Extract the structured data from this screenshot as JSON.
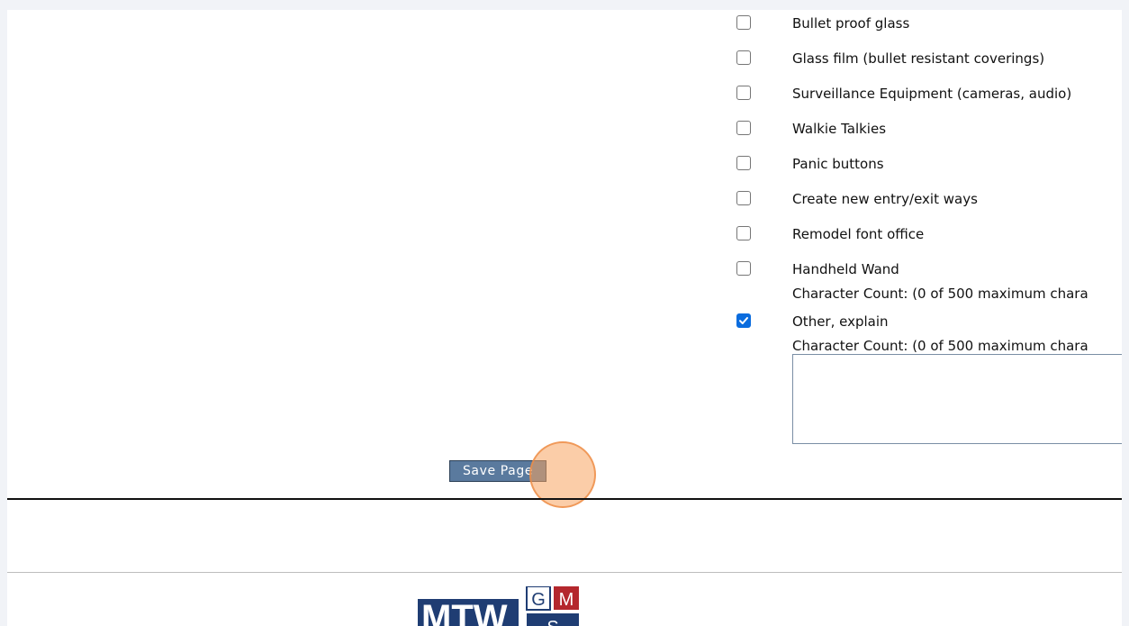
{
  "options": [
    {
      "label": "Bullet proof glass",
      "checked": false
    },
    {
      "label": "Glass film (bullet resistant coverings)",
      "checked": false
    },
    {
      "label": "Surveillance Equipment (cameras, audio)",
      "checked": false
    },
    {
      "label": "Walkie Talkies",
      "checked": false
    },
    {
      "label": "Panic buttons",
      "checked": false
    },
    {
      "label": "Create new entry/exit ways",
      "checked": false
    },
    {
      "label": "Remodel font office",
      "checked": false
    },
    {
      "label": "Handheld Wand",
      "checked": false
    },
    {
      "label": "Other, explain",
      "checked": true
    }
  ],
  "char_count_1": "Character Count: (0 of 500 maximum chara",
  "char_count_2": "Character Count: (0 of 500 maximum chara",
  "explain_value": "",
  "save_button_label": "Save Page",
  "logo": {
    "main_text": "MTW",
    "letters": [
      "G",
      "M",
      "S"
    ],
    "colors": {
      "navy": "#1f3d73",
      "red": "#b4272d"
    }
  }
}
